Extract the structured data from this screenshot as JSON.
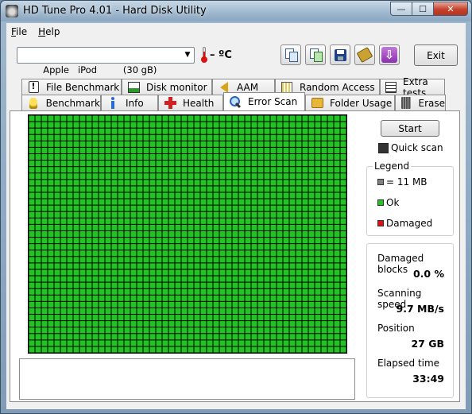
{
  "window": {
    "title": "HD Tune Pro 4.01 - Hard Disk Utility",
    "controls": {
      "minimize": "—",
      "maximize": "☐",
      "close": "✕"
    }
  },
  "menu": [
    {
      "label": "File",
      "accel": "F",
      "rest": "ile"
    },
    {
      "label": "Help",
      "accel": "H",
      "rest": "elp"
    }
  ],
  "toolbar": {
    "drive": "Apple   iPod         (30 gB)",
    "temperature": "– ºC",
    "exit_label": "Exit",
    "buttons": [
      "copy-text-icon",
      "copy-screenshot-icon",
      "save-icon",
      "options-icon",
      "download-icon"
    ]
  },
  "tabs": {
    "row1": [
      {
        "label": "File Benchmark",
        "icon": "file-benchmark-icon"
      },
      {
        "label": "Disk monitor",
        "icon": "disk-monitor-icon"
      },
      {
        "label": "AAM",
        "icon": "speaker-icon"
      },
      {
        "label": "Random Access",
        "icon": "random-access-icon"
      },
      {
        "label": "Extra tests",
        "icon": "extra-tests-icon"
      }
    ],
    "row2": [
      {
        "label": "Benchmark",
        "icon": "benchmark-icon"
      },
      {
        "label": "Info",
        "icon": "info-icon"
      },
      {
        "label": "Health",
        "icon": "health-icon"
      },
      {
        "label": "Error Scan",
        "icon": "magnifier-icon",
        "active": true
      },
      {
        "label": "Folder Usage",
        "icon": "folder-icon"
      },
      {
        "label": "Erase",
        "icon": "erase-icon"
      }
    ]
  },
  "scan": {
    "start_label": "Start",
    "quick_scan_label": "Quick scan",
    "quick_scan_checked": true,
    "grid": {
      "columns": 50,
      "rows": 37,
      "block_color": "#22c422",
      "line_color": "#000000",
      "state": "all-ok"
    },
    "log_text": ""
  },
  "legend": {
    "title": "Legend",
    "items": [
      {
        "label": "= 11 MB",
        "color": "#808080"
      },
      {
        "label": "Ok",
        "color": "#22c422"
      },
      {
        "label": "Damaged",
        "color": "#dd1111"
      }
    ]
  },
  "stats": {
    "damaged_blocks_label": "Damaged blocks",
    "damaged_blocks_value": "0.0 %",
    "scanning_speed_label": "Scanning speed",
    "scanning_speed_value": "9.7 MB/s",
    "position_label": "Position",
    "position_value": "27 GB",
    "elapsed_label": "Elapsed time",
    "elapsed_value": "33:49"
  }
}
